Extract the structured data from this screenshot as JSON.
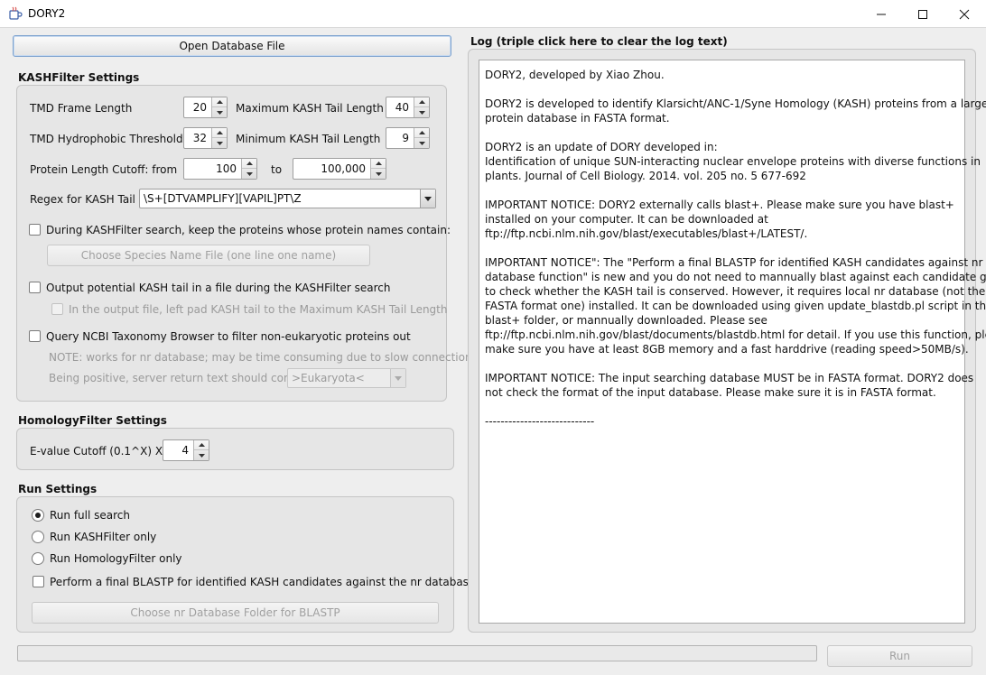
{
  "window": {
    "title": "DORY2"
  },
  "toolbar": {
    "open_db_label": "Open Database File"
  },
  "kash": {
    "section_title": "KASHFilter Settings",
    "tmd_frame_label": "TMD Frame Length",
    "tmd_frame_value": "20",
    "max_tail_label": "Maximum KASH Tail Length",
    "max_tail_value": "40",
    "tmd_hydro_label": "TMD Hydrophobic Threshold",
    "tmd_hydro_value": "32",
    "min_tail_label": "Minimum KASH Tail Length",
    "min_tail_value": "9",
    "length_cutoff_label": "Protein Length Cutoff: from",
    "length_from_value": "100",
    "length_to_label": "to",
    "length_to_value": "100,000",
    "regex_label": "Regex for KASH Tail",
    "regex_value": "\\S+[DTVAMPLIFY][VAPIL]PT\\Z",
    "keep_names_label": "During KASHFilter search, keep the proteins whose protein names contain:",
    "species_button": "Choose Species Name File (one line one name)",
    "output_tail_label": "Output potential KASH tail in a file during the KASHFilter search",
    "left_pad_label": "In the output file, left pad KASH tail to the Maximum KASH Tail Length",
    "ncbi_label": "Query NCBI Taxonomy Browser to filter non-eukaryotic proteins out",
    "ncbi_note": "NOTE: works for nr database; may be time consuming due to slow connection",
    "positive_label": "Being positive, server return text should contain",
    "positive_value": ">Eukaryota<"
  },
  "homology": {
    "section_title": "HomologyFilter Settings",
    "evalue_label": "E-value Cutoff (0.1^X) X=",
    "evalue_value": "4"
  },
  "run": {
    "section_title": "Run Settings",
    "options": [
      "Run full search",
      "Run KASHFilter only",
      "Run HomologyFilter only"
    ],
    "selected": "Run full search",
    "blastp_label": "Perform a final BLASTP for identified KASH candidates against the nr database",
    "nr_folder_button": "Choose nr Database Folder for BLASTP",
    "run_button": "Run",
    "progress": 0
  },
  "log": {
    "header": "Log (triple click here to clear the log text)",
    "lines": [
      "DORY2, developed by Xiao Zhou.",
      "",
      "DORY2 is developed to identify Klarsicht/ANC-1/Syne Homology (KASH) proteins from a large",
      "protein database in FASTA format.",
      "",
      "DORY2 is an update of DORY developed in:",
      "Identification of unique SUN-interacting nuclear envelope proteins with diverse functions in",
      "plants. Journal of Cell Biology. 2014. vol. 205 no. 5 677-692",
      "",
      "IMPORTANT NOTICE: DORY2 externally calls blast+. Please make sure you have blast+",
      "installed on your computer. It can be downloaded at",
      "ftp://ftp.ncbi.nlm.nih.gov/blast/executables/blast+/LATEST/.",
      "",
      "IMPORTANT NOTICE\": The \"Perform a final BLASTP for identified KASH candidates against nr",
      "database function\" is new and you do not need to mannually blast against each candidate group",
      "to check whether the KASH tail is conserved. However, it requires local nr database (not the",
      "FASTA format one) installed. It can be downloaded using given update_blastdb.pl script in the",
      "blast+ folder, or mannually downloaded. Please see",
      "ftp://ftp.ncbi.nlm.nih.gov/blast/documents/blastdb.html for detail. If you use this function, please",
      "make sure you have at least 8GB memory and a fast harddrive (reading speed>50MB/s).",
      "",
      "IMPORTANT NOTICE: The input searching database MUST be in FASTA format. DORY2 does",
      "not check the format of the input database. Please make sure it is in FASTA format.",
      "",
      "----------------------------"
    ]
  },
  "icons": {
    "app": "coffee-cup-icon",
    "minimize": "minimize-icon",
    "maximize": "maximize-icon",
    "close": "close-icon"
  }
}
